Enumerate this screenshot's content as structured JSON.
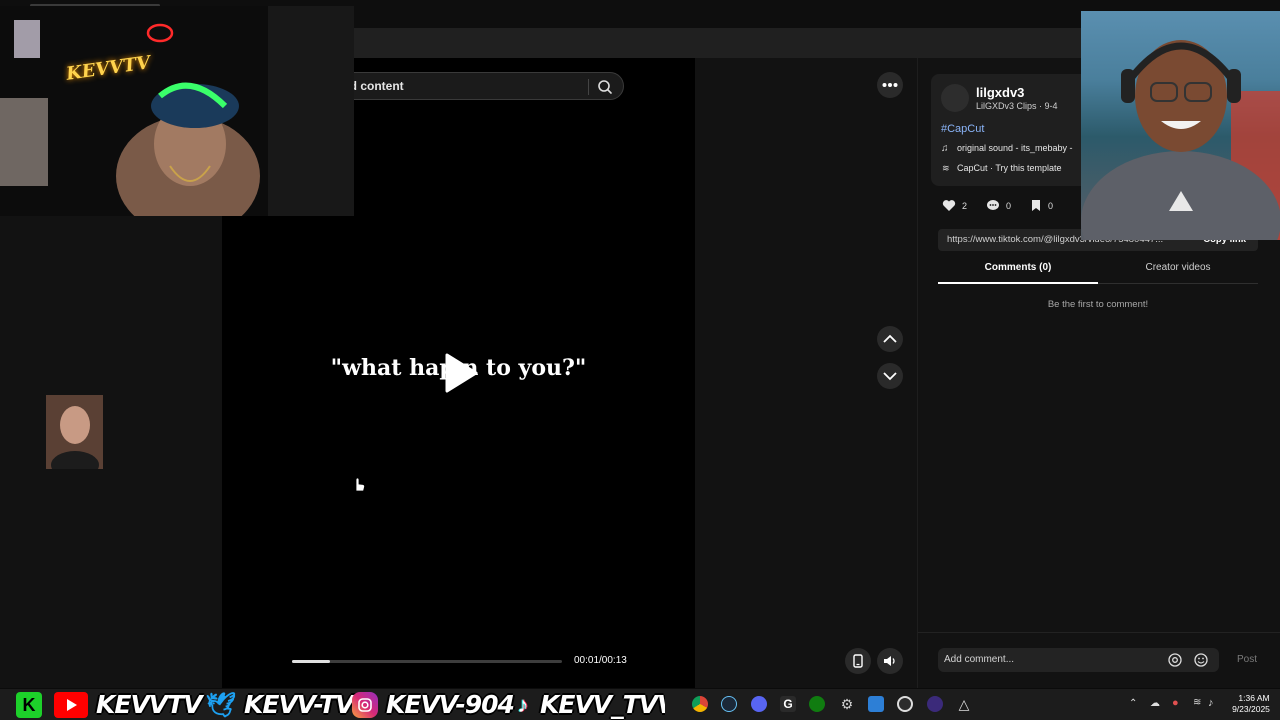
{
  "search": {
    "text": "ed content"
  },
  "video": {
    "caption": "\"what hap     n to you?\"",
    "time": "00:01/00:13",
    "progress": 0.14
  },
  "author": {
    "name": "lilgxdv3",
    "subtitle": "LilGXDv3 Clips · 9-4",
    "hashtag": "#CapCut",
    "sound": "original sound - its_mebaby -",
    "template": "CapCut · Try this template"
  },
  "stats": {
    "likes": "2",
    "comments": "0",
    "saves": "0"
  },
  "share": {
    "url": "https://www.tiktok.com/@lilgxdv3/video/75480447...",
    "copy_label": "Copy link"
  },
  "tabs": {
    "comments": "Comments (0)",
    "creator": "Creator videos"
  },
  "comments": {
    "empty": "Be the first to comment!",
    "placeholder": "Add comment...",
    "post": "Post"
  },
  "overlay": {
    "neon_logo": "KEVVTV",
    "handles": [
      "KEVVTV",
      "KEVV-TV",
      "KEVV-904",
      "KEVV_TVV"
    ]
  },
  "taskbar": {
    "icons": [
      "chrome-icon",
      "steam-icon",
      "discord-icon",
      "g-hub-icon",
      "xbox-icon",
      "settings-icon",
      "store-icon",
      "obs-icon",
      "media-icon",
      "app-icon"
    ],
    "time": "1:36 AM",
    "date": "9/23/2025"
  },
  "colors": {
    "accent_link": "#8ab4f8",
    "panel_bg": "#121212",
    "video_bg": "#000000"
  }
}
